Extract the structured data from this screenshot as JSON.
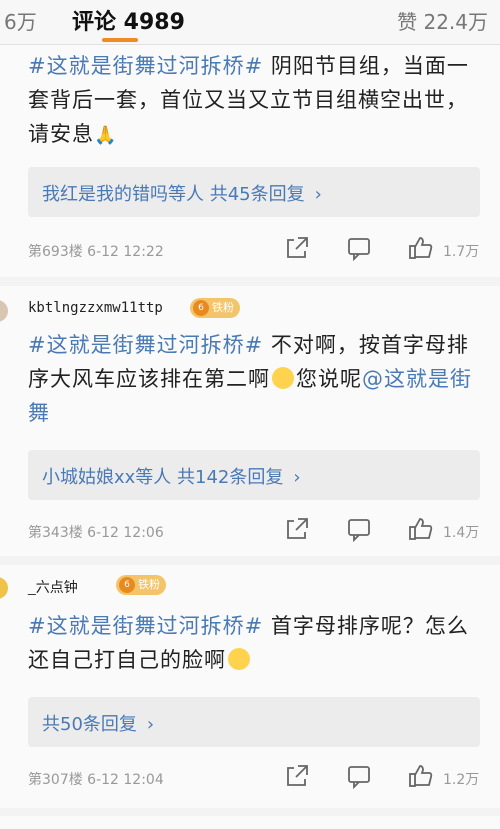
{
  "tabs": {
    "shares": "6万",
    "comments": "评论 4989",
    "likes": "赞 22.4万"
  },
  "comments": [
    {
      "topic": "#这就是街舞过河拆桥#",
      "text_a": " 阴阳节目组，当面一套背后一套，首位又当又立节目组横空出世，请安息",
      "emoji_end": "🙏",
      "reply_summary": "我红是我的错吗等人  共45条回复",
      "floor_time": "第693楼 6-12 12:22",
      "likes": "1.7万"
    },
    {
      "username": "kbtlngzzxmw11ttp",
      "badge": "铁粉",
      "badge_level": "6",
      "topic": "#这就是街舞过河拆桥#",
      "text_a": " 不对啊，按首字母排序大风车应该排在第二啊",
      "text_b": "您说呢",
      "mention": "@这就是街舞",
      "reply_summary": "小城姑娘xx等人  共142条回复",
      "floor_time": "第343楼 6-12 12:06",
      "likes": "1.4万"
    },
    {
      "username": "_六点钟",
      "badge": "铁粉",
      "badge_level": "6",
      "topic": "#这就是街舞过河拆桥#",
      "text_a": " 首字母排序呢？怎么还自己打自己的脸啊",
      "reply_summary": "共50条回复",
      "floor_time": "第307楼 6-12 12:04",
      "likes": "1.2万"
    }
  ],
  "colors": {
    "accent": "#f08a24",
    "link": "#4a7ab5",
    "badge": "#f4c46b"
  }
}
